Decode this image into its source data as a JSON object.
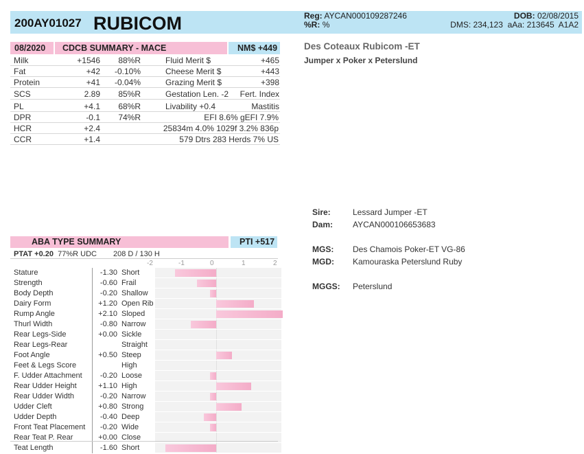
{
  "header": {
    "code": "200AY01027",
    "name": "RUBICOM",
    "reg_label": "Reg:",
    "reg_value": "AYCAN000109287246",
    "r_label": "%R:",
    "r_value": "%",
    "dob_label": "DOB:",
    "dob_value": "02/08/2015",
    "dms": "DMS: 234,123",
    "aaa": "aAa: 213645",
    "a1a2": "A1A2"
  },
  "cdcb": {
    "date": "08/2020",
    "title": "CDCB SUMMARY - MACE",
    "nm": "NM$ +449",
    "rows": [
      {
        "trait": "Milk",
        "value": "+1546",
        "rel": "88%R",
        "mtrait": "Fluid Merit $",
        "mval": "+465"
      },
      {
        "trait": "Fat",
        "value": "+42",
        "rel": "-0.10%",
        "mtrait": "Cheese Merit $",
        "mval": "+443"
      },
      {
        "trait": "Protein",
        "value": "+41",
        "rel": "-0.04%",
        "mtrait": "Grazing Merit $",
        "mval": "+398"
      },
      {
        "trait": "SCS",
        "value": "2.89",
        "rel": "85%R",
        "mtrait": "Gestation Len. -2",
        "mval": "Fert. Index"
      },
      {
        "trait": "PL",
        "value": "+4.1",
        "rel": "68%R",
        "mtrait": "Livability  +0.4",
        "mval": "Mastitis"
      },
      {
        "trait": "DPR",
        "value": "-0.1",
        "rel": "74%R",
        "mtrait": "EFI  8.6%  gEFI  7.9%",
        "mval": ""
      },
      {
        "trait": "HCR",
        "value": "+2.4",
        "rel": "",
        "mtrait": "25834m  4.0%  1029f  3.2%  836p",
        "mval": ""
      },
      {
        "trait": "CCR",
        "value": "+1.4",
        "rel": "",
        "mtrait": "579 Dtrs  283 Herds  7% US",
        "mval": ""
      }
    ]
  },
  "aba": {
    "title": "ABA TYPE SUMMARY",
    "pti": "PTI +517",
    "ptat": "PTAT +0.20",
    "ptat_rest": "77%R  UDC",
    "daughters": "208 D /  130 H",
    "scale": [
      "-2",
      "-1",
      "0",
      "1",
      "2"
    ],
    "traits": [
      {
        "name": "Stature",
        "value": "-1.30",
        "word": "Short",
        "num": -1.3
      },
      {
        "name": "Strength",
        "value": "-0.60",
        "word": "Frail",
        "num": -0.6
      },
      {
        "name": "Body Depth",
        "value": "-0.20",
        "word": "Shallow",
        "num": -0.2
      },
      {
        "name": "Dairy Form",
        "value": "+1.20",
        "word": "Open Rib",
        "num": 1.2
      },
      {
        "name": "Rump Angle",
        "value": "+2.10",
        "word": "Sloped",
        "num": 2.1
      },
      {
        "name": "Thurl Width",
        "value": "-0.80",
        "word": "Narrow",
        "num": -0.8
      },
      {
        "name": "Rear Legs-Side",
        "value": "+0.00",
        "word": "Sickle",
        "num": 0.0
      },
      {
        "name": "Rear Legs-Rear",
        "value": "",
        "word": "Straight",
        "num": 0.0
      },
      {
        "name": "Foot Angle",
        "value": "+0.50",
        "word": "Steep",
        "num": 0.5
      },
      {
        "name": "Feet & Legs Score",
        "value": "",
        "word": "High",
        "num": 0.0
      },
      {
        "name": "F. Udder Attachment",
        "value": "-0.20",
        "word": "Loose",
        "num": -0.2
      },
      {
        "name": "Rear Udder Height",
        "value": "+1.10",
        "word": "High",
        "num": 1.1
      },
      {
        "name": "Rear Udder Width",
        "value": "-0.20",
        "word": "Narrow",
        "num": -0.2
      },
      {
        "name": "Udder Cleft",
        "value": "+0.80",
        "word": "Strong",
        "num": 0.8
      },
      {
        "name": "Udder Depth",
        "value": "-0.40",
        "word": "Deep",
        "num": -0.4
      },
      {
        "name": "Front Teat Placement",
        "value": "-0.20",
        "word": "Wide",
        "num": -0.2
      },
      {
        "name": "Rear Teat P. Rear",
        "value": "+0.00",
        "word": "Close",
        "num": 0.0
      },
      {
        "name": "Teat Length",
        "value": "-1.60",
        "word": "Short",
        "num": -1.6
      }
    ]
  },
  "right": {
    "full_name": "Des Coteaux Rubicom -ET",
    "cross": "Jumper x Poker x Peterslund"
  },
  "pedigree": {
    "sire_label": "Sire:",
    "sire": "Lessard Jumper -ET",
    "dam_label": "Dam:",
    "dam": "AYCAN000106653683",
    "mgs_label": "MGS:",
    "mgs": "Des Chamois Poker-ET VG-86",
    "mgd_label": "MGD:",
    "mgd": "Kamouraska Peterslund Ruby",
    "mggs_label": "MGGS:",
    "mggs": "Peterslund"
  },
  "colors": {
    "blue": "#bde4f4",
    "pink": "#f7bfd6"
  }
}
